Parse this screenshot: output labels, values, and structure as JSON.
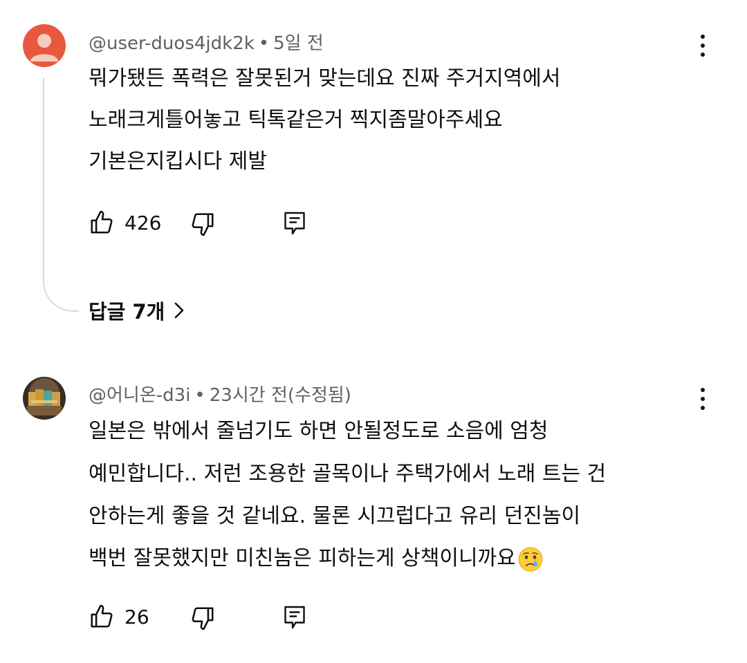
{
  "comments": [
    {
      "author": "@user-duos4jdk2k",
      "separator": "•",
      "time": "5일 전",
      "lines": [
        "뭐가됐든 폭력은 잘못된거 맞는데요 진짜 주거지역에서",
        "노래크게틀어놓고 틱톡같은거 찍지좀말아주세요",
        "기본은지킵시다 제발"
      ],
      "likes": "426",
      "replies_label": "답글 7개",
      "avatar_icon": "default-person-icon",
      "avatar_color": "#e8583e"
    },
    {
      "author": "@어니온-d3i",
      "separator": "•",
      "time": "23시간 전(수정됨)",
      "lines": [
        "일본은 밖에서 줄넘기도 하면 안될정도로 소음에 엄청",
        "예민합니다.. 저런 조용한 골목이나 주택가에서 노래 트는 건",
        "안하는게 좋을 것 같네요. 물론 시끄럽다고 유리 던진놈이",
        "백번 잘못했지만 미친놈은 피하는게 상책이니까요"
      ],
      "trailing_emoji": "crying-face-emoji",
      "likes": "26"
    }
  ],
  "icons": {
    "like": "thumbs-up-icon",
    "dislike": "thumbs-down-icon",
    "reply": "reply-comment-icon",
    "menu": "more-vertical-icon",
    "chevron": "chevron-right-icon"
  }
}
